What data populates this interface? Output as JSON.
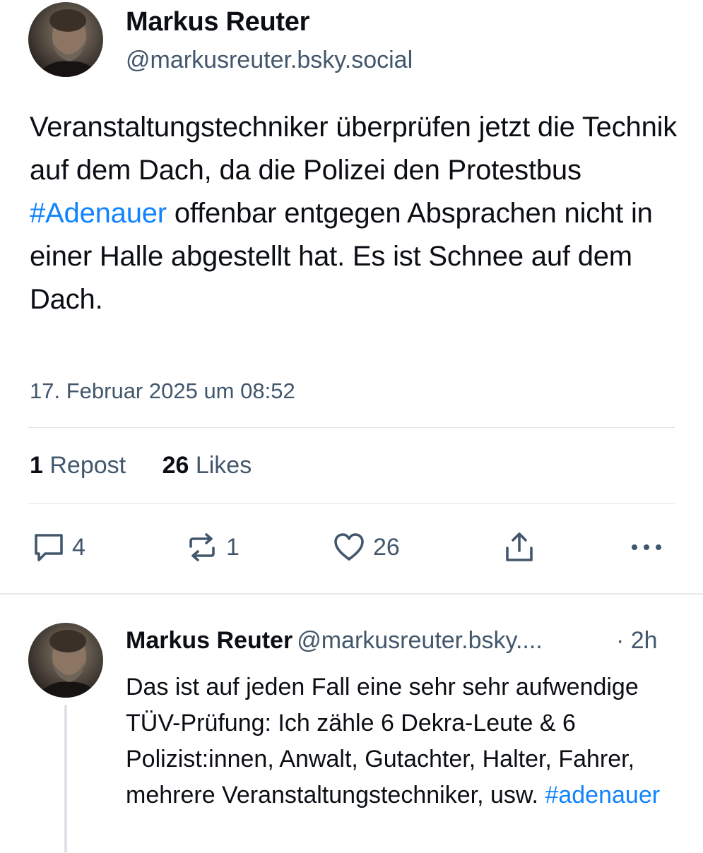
{
  "post": {
    "author_name": "Markus Reuter",
    "author_handle": "@markusreuter.bsky.social",
    "text_before": "Veranstaltungstechniker überprüfen jetzt die Technik auf dem Dach, da die Polizei den Protestbus ",
    "hashtag": "#Adenauer",
    "text_after": " offenbar entgegen Absprachen nicht in einer Halle abgestellt hat. Es ist Schnee auf dem Dach.",
    "timestamp": "17. Februar 2025 um 08:52",
    "stats": {
      "reposts_count": "1",
      "reposts_label": "Repost",
      "likes_count": "26",
      "likes_label": "Likes"
    },
    "actions": {
      "reply_count": "4",
      "repost_count": "1",
      "like_count": "26"
    }
  },
  "reply": {
    "author_name": "Markus Reuter",
    "author_handle": "@markusreuter.bsky....",
    "time": "· 2h",
    "text": "Das ist auf jeden Fall eine sehr sehr aufwendige TÜV-Prüfung: Ich zähle 6 Dekra-Leute & 6 Polizist:innen, Anwalt, Gutachter, Halter, Fahrer, mehrere Veranstaltungstechniker, usw. ",
    "hashtag": "#adenauer"
  },
  "colors": {
    "accent": "#1083fe",
    "muted": "#42576c",
    "text": "#0b0f14",
    "divider": "#dfe3e8"
  },
  "icons": [
    "chat-bubble-icon",
    "repost-icon",
    "heart-icon",
    "share-icon",
    "more-icon"
  ]
}
